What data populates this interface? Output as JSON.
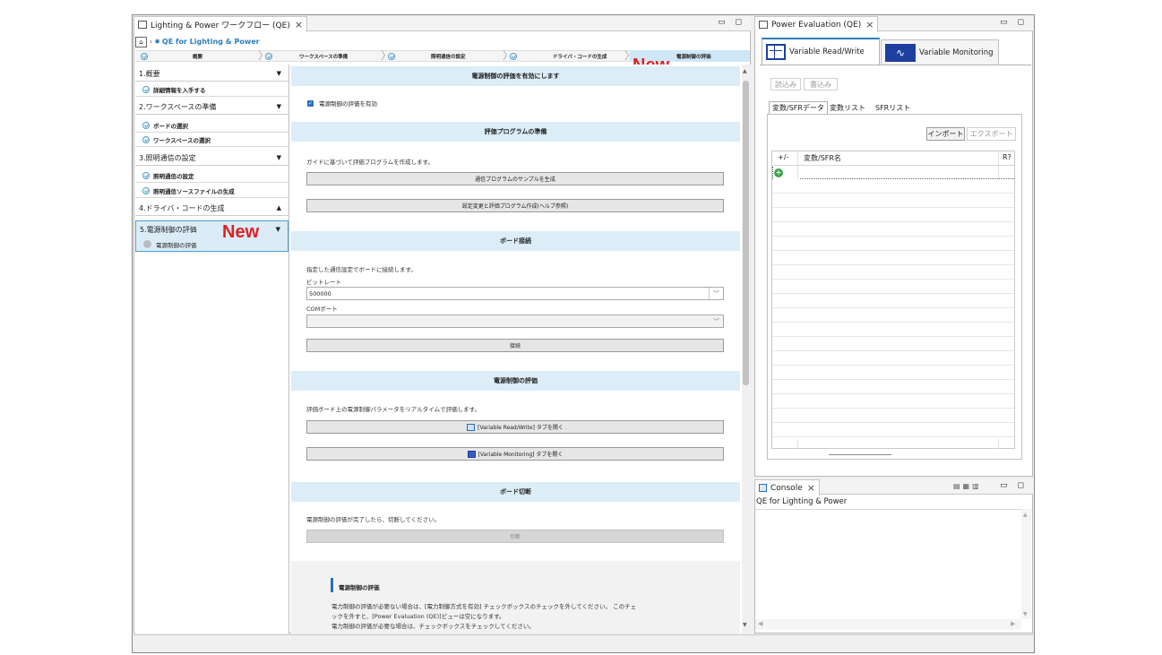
{
  "workflow": {
    "tab_title": "Lighting & Power ワークフロー (QE)",
    "breadcrumb": "QE for Lighting & Power",
    "steps": [
      "概要",
      "ワークスペースの準備",
      "照明通信の設定",
      "ドライバ・コードの生成",
      "電源制御の評価"
    ],
    "new_label": "New",
    "sidebar": {
      "sections": [
        {
          "label": "1.概要",
          "items": [
            "詳細情報を入手する"
          ]
        },
        {
          "label": "2.ワークスペースの準備",
          "items": [
            "ボードの選択",
            "ワークスペースの選択"
          ]
        },
        {
          "label": "3.照明通信の設定",
          "items": [
            "照明通信の設定",
            "照明通信ソースファイルの生成"
          ]
        },
        {
          "label": "4.ドライバ・コードの生成",
          "items": []
        },
        {
          "label": "5.電源制御の評価",
          "items": [
            "電源制御の評価"
          ]
        }
      ]
    },
    "content": {
      "enable_header": "電源制御の評価を有効にします",
      "enable_checkbox": "電源制御の評価を有効",
      "prep_header": "評価プログラムの準備",
      "prep_text": "ガイドに基づいて評価プログラムを作成します。",
      "prep_btn1": "通信プログラムのサンプルを生成",
      "prep_btn2": "設定変更と評価プログラム作成(ヘルプ参照)",
      "board_header": "ボード接続",
      "board_text": "指定した通信設定でボードに接続します。",
      "bitrate_label": "ビットレート",
      "bitrate_value": "500000",
      "com_label": "COMポート",
      "connect_btn": "接続",
      "eval_header": "電源制御の評価",
      "eval_text": "評価ボード上の電源制御パラメータをリアルタイムで評価します。",
      "eval_btn1": "[Variable Read/Write] タブを開く",
      "eval_btn2": "[Variable Monitoring] タブを開く",
      "disc_header": "ボード切断",
      "disc_text": "電源制御の評価が完了したら、切断してください。",
      "disc_btn": "切断",
      "help_title": "電源制御の評価",
      "help_line1": "電力制御の評価が必要ない場合は、[電力制御方式を有効] チェックボックスのチェックを外してください。 このチェ",
      "help_line2": "ックを外すと、[Power Evaluation (QE)]ビューは空になります。",
      "help_line3": "電力制御の評価が必要な場合は、チェックボックスをチェックしてください。"
    }
  },
  "power": {
    "tab_title": "Power Evaluation (QE)",
    "tab_rw": "Variable Read/Write",
    "tab_mon": "Variable Monitoring",
    "read_btn": "読込み",
    "write_btn": "書込み",
    "subtabs": [
      "変数/SFRデータ",
      "変数リスト",
      "SFRリスト"
    ],
    "import_btn": "インポート",
    "export_btn": "エクスポート",
    "col_pm": "+/-",
    "col_name": "変数/SFR名",
    "col_r": "R?"
  },
  "console": {
    "tab_title": "Console",
    "text": "QE for Lighting & Power"
  }
}
